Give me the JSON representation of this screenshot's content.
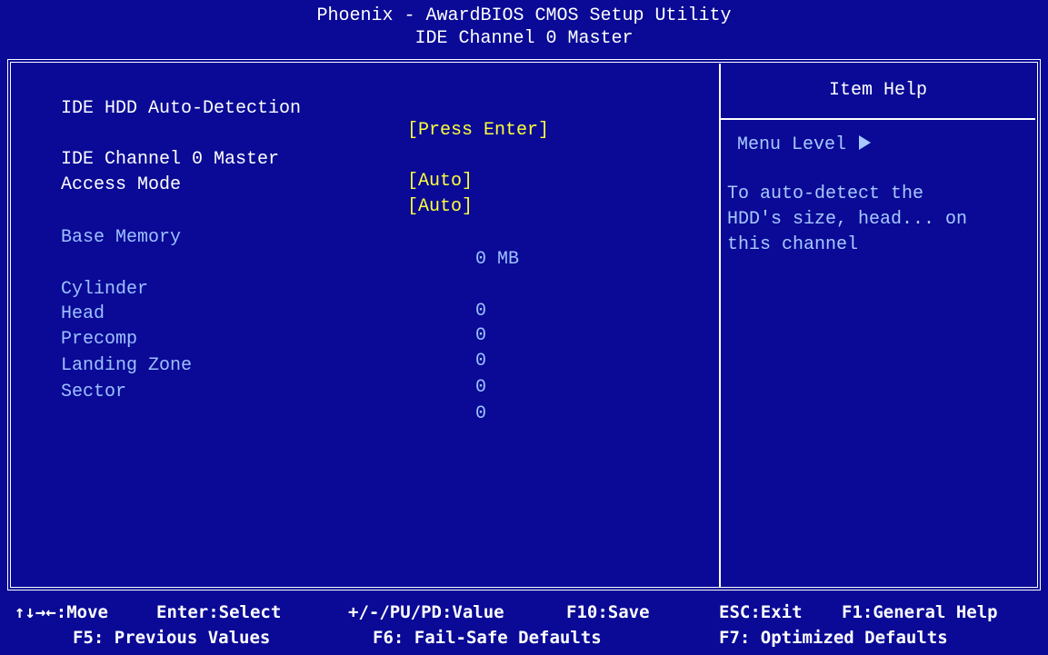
{
  "header": {
    "title": "Phoenix - AwardBIOS CMOS Setup Utility",
    "subtitle": "IDE Channel 0 Master"
  },
  "settings": {
    "auto_detect": {
      "label": "IDE HDD Auto-Detection",
      "value": "[Press Enter]"
    },
    "channel_master": {
      "label": "IDE Channel 0 Master",
      "value": "[Auto]"
    },
    "access_mode": {
      "label": "Access Mode",
      "value": "[Auto]"
    },
    "base_memory": {
      "label": "Base Memory",
      "value": "0 MB"
    },
    "cylinder": {
      "label": "Cylinder",
      "value": "0"
    },
    "head": {
      "label": "Head",
      "value": "0"
    },
    "precomp": {
      "label": "Precomp",
      "value": "0"
    },
    "landing_zone": {
      "label": "Landing Zone",
      "value": "0"
    },
    "sector": {
      "label": "Sector",
      "value": "0"
    }
  },
  "help": {
    "title": "Item Help",
    "menu_level": "Menu Level",
    "menu_level_icon": "right-triangle-icon",
    "text": "To auto-detect the\nHDD's size, head... on\nthis channel"
  },
  "footer": {
    "move": "↑↓→←:Move",
    "select": "Enter:Select",
    "value": "+/-/PU/PD:Value",
    "save": "F10:Save",
    "exit": "ESC:Exit",
    "help": "F1:General Help",
    "previous": "F5: Previous Values",
    "failsafe": "F6: Fail-Safe Defaults",
    "optimized": "F7: Optimized Defaults"
  },
  "colors": {
    "background": "#0a0a96",
    "text_white": "#ffffff",
    "value_yellow": "#ffff3a",
    "disabled_cyan": "#9ec0ff"
  }
}
